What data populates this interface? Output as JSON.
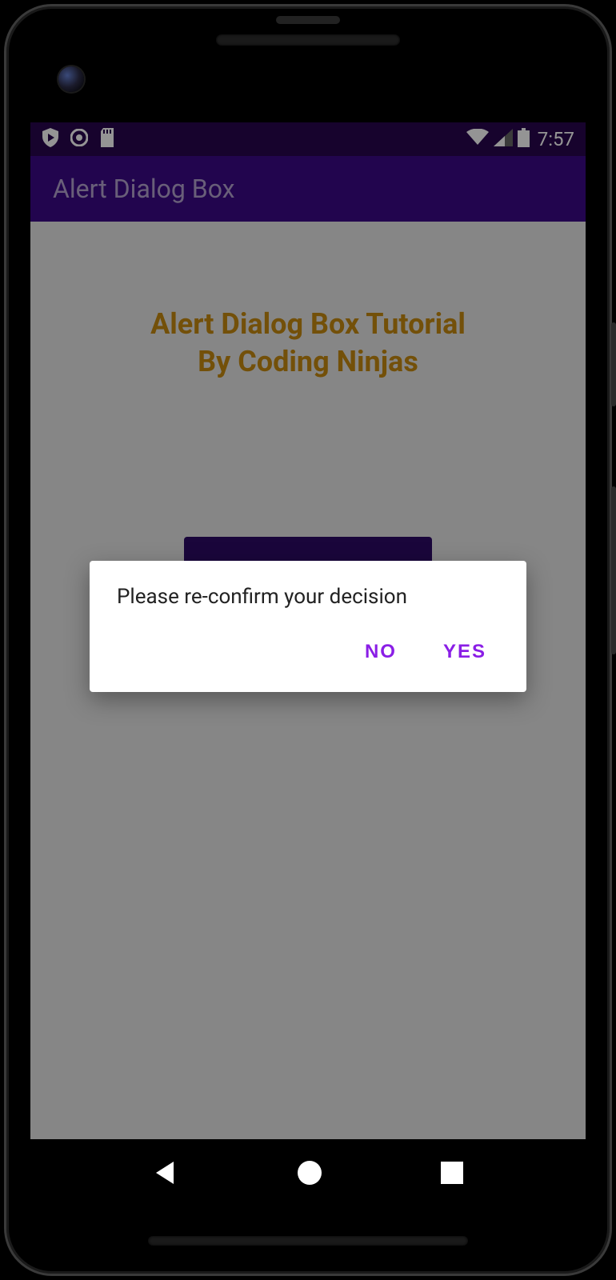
{
  "status_bar": {
    "time": "7:57"
  },
  "app_bar": {
    "title": "Alert Dialog Box"
  },
  "content": {
    "heading_line1": "Alert Dialog Box Tutorial",
    "heading_line2": "By Coding Ninjas"
  },
  "dialog": {
    "message": "Please re-confirm your decision",
    "negative_label": "NO",
    "positive_label": "YES"
  }
}
